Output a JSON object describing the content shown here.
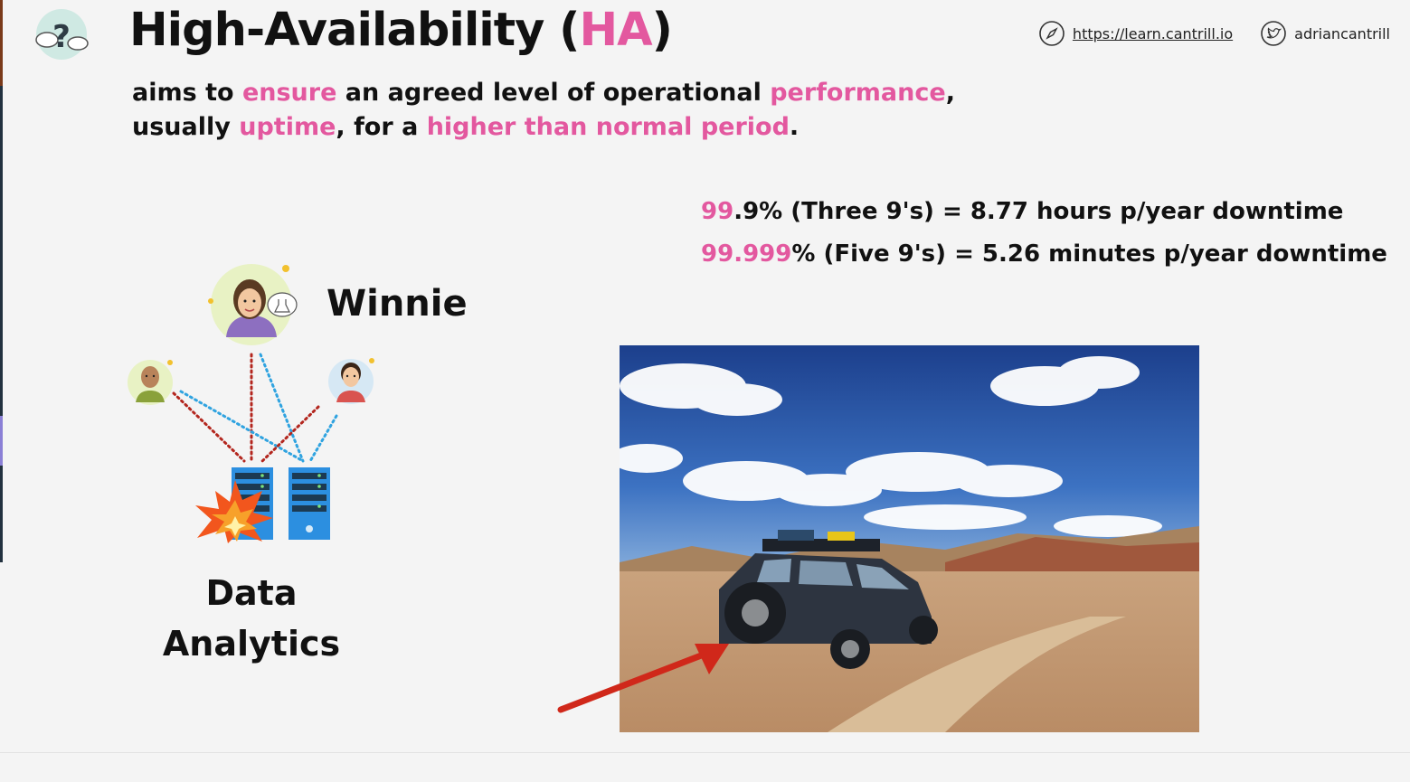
{
  "header": {
    "title_main": "High-Availability (",
    "title_accent": "HA",
    "title_end": ")",
    "links": [
      {
        "icon": "compass-icon",
        "text": "https://learn.cantrill.io"
      },
      {
        "icon": "twitter-icon",
        "text": "adriancantrill"
      }
    ]
  },
  "definition": {
    "line1": [
      {
        "text": "aims to ",
        "accent": false
      },
      {
        "text": "ensure",
        "accent": true
      },
      {
        "text": " an agreed level of operational ",
        "accent": false
      },
      {
        "text": "performance",
        "accent": true
      },
      {
        "text": ",",
        "accent": false
      }
    ],
    "line2": [
      {
        "text": "usually ",
        "accent": false
      },
      {
        "text": "uptime",
        "accent": true
      },
      {
        "text": ", for a ",
        "accent": false
      },
      {
        "text": "higher than normal period",
        "accent": true
      },
      {
        "text": ".",
        "accent": false
      }
    ]
  },
  "availability": [
    {
      "a": "99",
      "b": ".9",
      "c": "% (Three 9's) = 8.77 hours p/year downtime"
    },
    {
      "a": "99",
      "b": ".999",
      "c": "% (Five 9's) = 5.26 minutes p/year downtime"
    }
  ],
  "diagram": {
    "main_user_label": "Winnie",
    "system_label_line1": "Data",
    "system_label_line2": "Analytics",
    "icons": [
      "winnie-avatar-icon",
      "user-avatar-icon",
      "server-icon",
      "explosion-icon"
    ]
  },
  "colors": {
    "accent": "#e3589f",
    "line_red": "#b3261e",
    "line_blue": "#2fa3e0",
    "server_blue": "#2c8fe0",
    "arrow_red": "#d0281a"
  }
}
